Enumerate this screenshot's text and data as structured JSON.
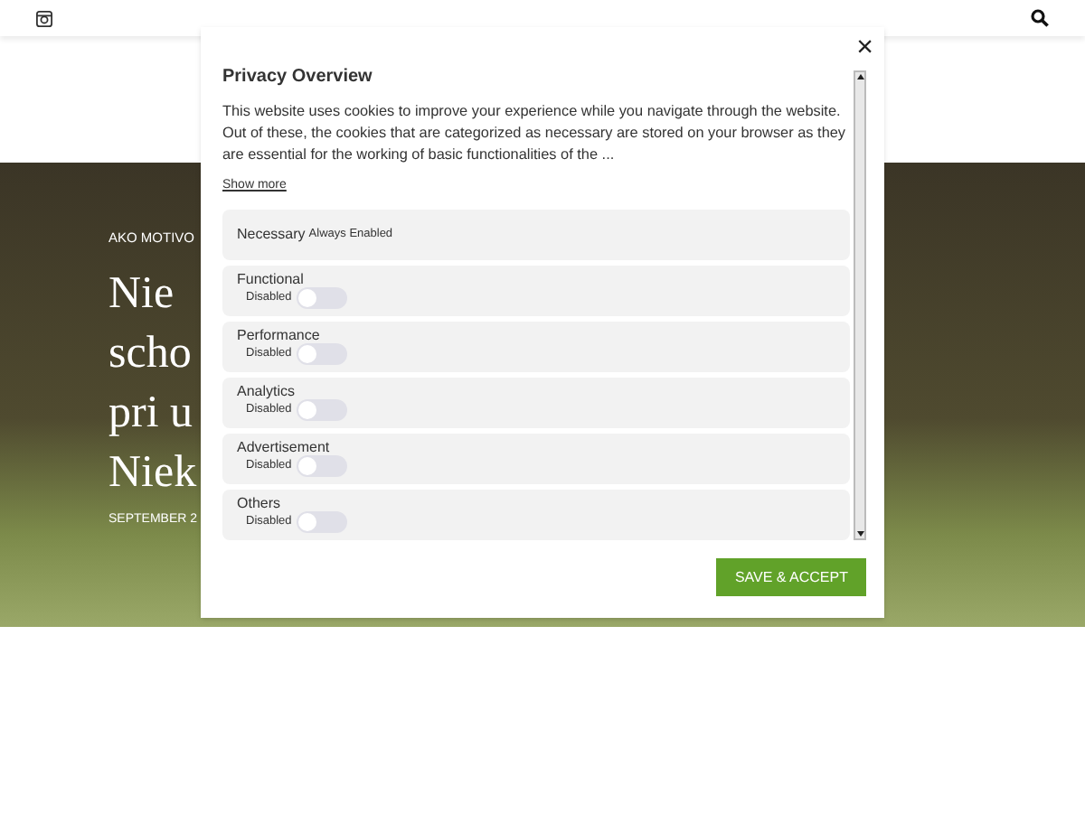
{
  "hero": {
    "category": "AKO MOTIVO",
    "title_lines": [
      "Nie",
      "scho",
      "pri u",
      "Niek"
    ],
    "date": "SEPTEMBER 2"
  },
  "modal": {
    "title": "Privacy Overview",
    "text": "This website uses cookies to improve your experience while you navigate through the website. Out of these, the cookies that are categorized as necessary are stored on your browser as they are essential for the working of basic functionalities of the ...",
    "show_more": "Show more",
    "close": "×",
    "categories": [
      {
        "kind": "fixed",
        "name": "Necessary",
        "status": "Always Enabled"
      },
      {
        "kind": "toggle",
        "name": "Functional",
        "status": "Disabled",
        "on": false
      },
      {
        "kind": "toggle",
        "name": "Performance",
        "status": "Disabled",
        "on": false
      },
      {
        "kind": "toggle",
        "name": "Analytics",
        "status": "Disabled",
        "on": false
      },
      {
        "kind": "toggle",
        "name": "Advertisement",
        "status": "Disabled",
        "on": false
      },
      {
        "kind": "toggle",
        "name": "Others",
        "status": "Disabled",
        "on": false
      }
    ],
    "save_button": "SAVE & ACCEPT"
  }
}
